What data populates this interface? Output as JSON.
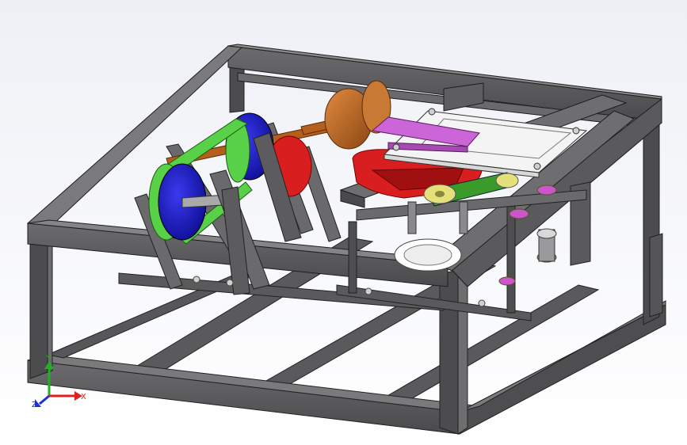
{
  "viewport": {
    "background": "#f4f5fa"
  },
  "model": {
    "frame_color": "#5e5e60",
    "frame_edge": "#2b2b2b",
    "pulley_blue": "#1a1ad0",
    "pulley_green": "#58d048",
    "crank_red": "#d81e1e",
    "shaft_orange": "#b4601c",
    "plate_white": "#f6f6f6",
    "slider_purple": "#cc66d8",
    "link_green": "#3a9a2a",
    "link_yellow": "#e6e07a",
    "gear_white": "#ffffff",
    "bushing_purple": "#cc55cc"
  },
  "triad": {
    "x_label": "X",
    "y_label": "Y",
    "z_label": "Z",
    "x_color": "#e02020",
    "y_color": "#20b020",
    "z_color": "#2030d0"
  }
}
